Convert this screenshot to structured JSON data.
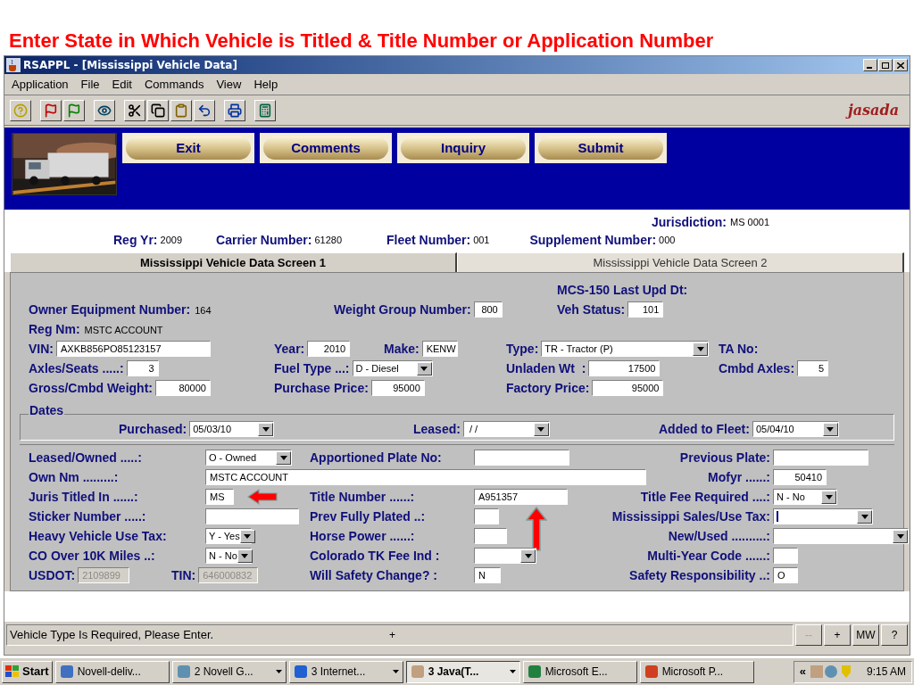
{
  "slide_title": "Enter State in Which Vehicle is Titled & Title Number or Application Number",
  "window": {
    "title": "RSAPPL - [Mississippi Vehicle Data]"
  },
  "menu": [
    "Application",
    "File",
    "Edit",
    "Commands",
    "View",
    "Help"
  ],
  "logo": "jasada",
  "action_buttons": [
    "Exit",
    "Comments",
    "Inquiry",
    "Submit"
  ],
  "header": {
    "jurisdiction": {
      "label": "Jurisdiction:",
      "value": "MS 0001"
    },
    "items": [
      {
        "label": "Reg Yr:",
        "value": "2009"
      },
      {
        "label": "Carrier Number:",
        "value": "61280"
      },
      {
        "label": "Fleet Number:",
        "value": "001"
      },
      {
        "label": "Supplement Number:",
        "value": "000"
      }
    ]
  },
  "tabs": [
    {
      "label": "Mississippi Vehicle Data Screen 1",
      "selected": true
    },
    {
      "label": "Mississippi Vehicle Data Screen 2",
      "selected": false
    }
  ],
  "top_rows": [
    [
      {
        "kind": "label",
        "label": "MCS-150 Last Upd Dt:"
      }
    ],
    [
      {
        "kind": "text",
        "label": "Owner Equipment Number:",
        "value": "164"
      },
      {
        "kind": "number",
        "label": "Weight Group Number:",
        "value": "800"
      },
      {
        "kind": "number",
        "label": "Veh Status:",
        "value": "101"
      }
    ],
    [
      {
        "kind": "text",
        "label": "Reg Nm:",
        "value": "MSTC ACCOUNT"
      }
    ],
    [
      {
        "kind": "input",
        "label": "VIN:",
        "value": "AXKB856PO85123157"
      },
      {
        "kind": "number",
        "label": "Year:",
        "value": "2010"
      },
      {
        "kind": "input",
        "label": "Make:",
        "value": "KENW"
      },
      {
        "kind": "select",
        "label": "Type:",
        "value": "TR - Tractor (P)"
      },
      {
        "kind": "label",
        "label": "TA No:"
      }
    ],
    [
      {
        "kind": "number",
        "label": "Axles/Seats .....:",
        "value": "3"
      },
      {
        "kind": "select",
        "label": "Fuel Type ...:",
        "value": "D - Diesel"
      },
      {
        "kind": "number",
        "label": "Unladen Wt  :",
        "value": "17500"
      },
      {
        "kind": "number",
        "label": "Cmbd Axles:",
        "value": "5"
      }
    ],
    [
      {
        "kind": "number",
        "label": "Gross/Cmbd Weight:",
        "value": "80000"
      },
      {
        "kind": "number",
        "label": "Purchase Price:",
        "value": "95000"
      },
      {
        "kind": "number",
        "label": "Factory Price:",
        "value": "95000"
      }
    ]
  ],
  "dates": {
    "title": "Dates",
    "fields": [
      {
        "kind": "select",
        "label": "Purchased:",
        "value": "05/03/10"
      },
      {
        "kind": "select",
        "label": "Leased:",
        "value": " / /"
      },
      {
        "kind": "select",
        "label": "Added to Fleet:",
        "value": "05/04/10"
      }
    ]
  },
  "bottom_rows": [
    [
      {
        "kind": "select",
        "label": "Leased/Owned .....:",
        "value": "O - Owned"
      },
      {
        "kind": "input",
        "label": "Apportioned Plate No:"
      },
      {
        "kind": "input",
        "label": "Previous Plate:"
      }
    ],
    [
      {
        "kind": "input",
        "label": "Own Nm .........:",
        "value": "MSTC ACCOUNT"
      },
      {
        "kind": "number",
        "label": "Mofyr ......:",
        "value": "50410"
      }
    ],
    [
      {
        "kind": "input",
        "label": "Juris Titled In ......:",
        "value": "MS"
      },
      {
        "kind": "input",
        "label": "Title Number ......:",
        "value": "A951357"
      },
      {
        "kind": "select",
        "label": "Title Fee Required ....:",
        "value": "N - No"
      }
    ],
    [
      {
        "kind": "input",
        "label": "Sticker Number .....:"
      },
      {
        "kind": "input",
        "label": "Prev Fully Plated ..:"
      },
      {
        "kind": "select",
        "label": "Mississippi Sales/Use Tax:",
        "focused": true
      }
    ],
    [
      {
        "kind": "select",
        "label": "Heavy Vehicle Use Tax:",
        "value": "Y - Yes"
      },
      {
        "kind": "input",
        "label": "Horse Power ......:"
      },
      {
        "kind": "select",
        "label": "New/Used ..........:"
      }
    ],
    [
      {
        "kind": "select",
        "label": "CO Over 10K Miles ..:",
        "value": "N - No"
      },
      {
        "kind": "select",
        "label": "Colorado TK Fee Ind :"
      },
      {
        "kind": "input",
        "label": "Multi-Year Code ......:"
      }
    ],
    [
      {
        "kind": "readonly",
        "label": "USDOT:",
        "value": "2109899"
      },
      {
        "kind": "readonly",
        "label": "TIN:",
        "value": "646000832"
      },
      {
        "kind": "input",
        "label": "Will Safety Change? :",
        "value": "N"
      },
      {
        "kind": "input",
        "label": "Safety Responsibility ..:",
        "value": "O"
      }
    ]
  ],
  "status_bar": {
    "message": "Vehicle Type Is Required, Please Enter.",
    "marker": "+",
    "buttons": [
      {
        "label": "--",
        "disabled": true
      },
      {
        "label": "+",
        "disabled": false
      },
      {
        "label": "MW",
        "disabled": false
      },
      {
        "label": "?",
        "disabled": false
      }
    ]
  },
  "taskbar": {
    "start": "Start",
    "items": [
      {
        "label": "Novell-deliv...",
        "grouped": false,
        "selected": false
      },
      {
        "label": "2 Novell G...",
        "grouped": true,
        "selected": false
      },
      {
        "label": "3 Internet...",
        "grouped": true,
        "selected": false
      },
      {
        "label": "3 Java(T...",
        "grouped": true,
        "selected": true
      },
      {
        "label": "Microsoft E...",
        "grouped": false,
        "selected": false
      },
      {
        "label": "Microsoft P...",
        "grouped": false,
        "selected": false
      }
    ],
    "tray_toggle": "«",
    "time": "9:15 AM"
  }
}
